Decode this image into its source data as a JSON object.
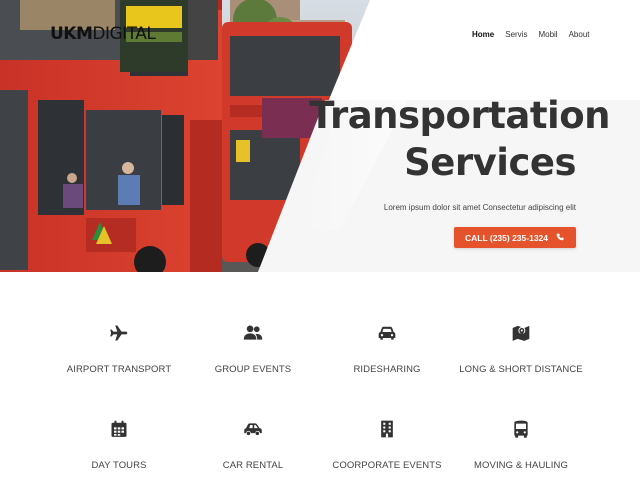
{
  "brand": {
    "logo_strong": "UKM",
    "logo_light": "DIGITAL"
  },
  "nav": {
    "items": [
      {
        "label": "Home",
        "active": true
      },
      {
        "label": "Servis"
      },
      {
        "label": "Mobil"
      },
      {
        "label": "About"
      }
    ]
  },
  "hero": {
    "title_line1": "Transportation",
    "title_line2": "Services",
    "subtitle": "Lorem ipsum dolor sit amet Consectetur adipiscing elit",
    "cta_label": "CALL (235) 235-1324",
    "cta_icon": "phone-icon",
    "accent_color": "#e5532d",
    "bus_color": "#d8392a"
  },
  "services": {
    "row1": [
      {
        "label": "AIRPORT TRANSPORT",
        "icon": "plane-icon"
      },
      {
        "label": "GROUP EVENTS",
        "icon": "users-icon"
      },
      {
        "label": "RIDESHARING",
        "icon": "car-icon"
      },
      {
        "label": "LONG & SHORT DISTANCE",
        "icon": "map-marker-icon"
      }
    ],
    "row2": [
      {
        "label": "DAY TOURS",
        "icon": "calendar-icon"
      },
      {
        "label": "CAR RENTAL",
        "icon": "car-side-icon"
      },
      {
        "label": "COORPORATE EVENTS",
        "icon": "building-icon"
      },
      {
        "label": "MOVING & HAULING",
        "icon": "bus-icon"
      }
    ]
  }
}
